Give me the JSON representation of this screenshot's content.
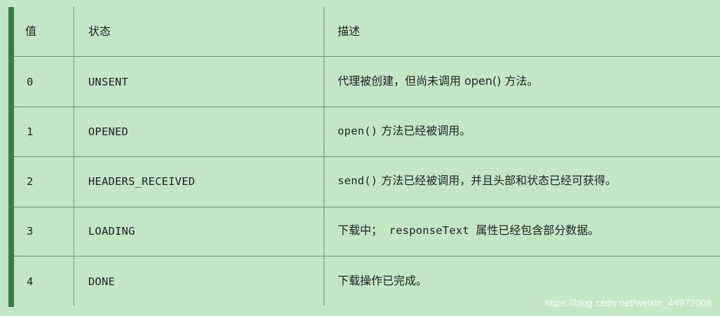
{
  "table": {
    "headers": [
      "值",
      "状态",
      "描述"
    ],
    "rows": [
      {
        "value": "0",
        "state": "UNSENT",
        "desc_parts": [
          "代理被创建，但尚未调用 open() 方法。"
        ]
      },
      {
        "value": "1",
        "state": "OPENED",
        "desc_parts": [
          "open()",
          " 方法已经被调用。"
        ]
      },
      {
        "value": "2",
        "state": "HEADERS_RECEIVED",
        "desc_parts": [
          "send()",
          " 方法已经被调用，并且头部和状态已经可获得。"
        ]
      },
      {
        "value": "3",
        "state": "LOADING",
        "desc_parts": [
          "下载中；",
          " responseText ",
          "属性已经包含部分数据。"
        ]
      },
      {
        "value": "4",
        "state": "DONE",
        "desc_parts": [
          "下载操作已完成。"
        ]
      }
    ]
  },
  "watermark": "https://blog.csdn.net/weixin_44972008",
  "colors": {
    "background": "#c2e6c6",
    "accent": "#3a7d46",
    "grid": "#6e8a72"
  }
}
